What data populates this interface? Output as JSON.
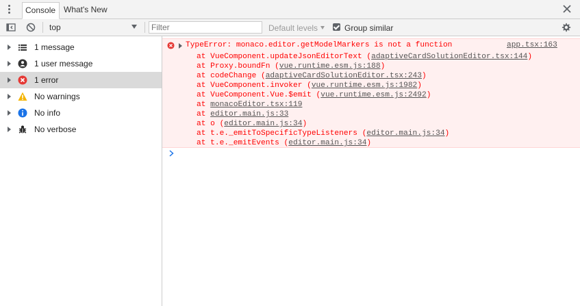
{
  "tabs": {
    "active": "Console",
    "inactive": "What's New"
  },
  "toolbar": {
    "context": "top",
    "filter_placeholder": "Filter",
    "levels": "Default levels",
    "group_similar": "Group similar",
    "group_similar_checked": true
  },
  "sidebar": {
    "items": [
      {
        "label": "1 message",
        "icon": "list-icon"
      },
      {
        "label": "1 user message",
        "icon": "user-icon"
      },
      {
        "label": "1 error",
        "icon": "error-icon",
        "selected": true
      },
      {
        "label": "No warnings",
        "icon": "warning-icon"
      },
      {
        "label": "No info",
        "icon": "info-icon"
      },
      {
        "label": "No verbose",
        "icon": "bug-icon"
      }
    ]
  },
  "console": {
    "error": {
      "message": "TypeError: monaco.editor.getModelMarkers is not a function",
      "source": "app.tsx:163",
      "stack": [
        {
          "text": "at VueComponent.updateJsonEditorText (",
          "link": "adaptiveCardSolutionEditor.tsx:144",
          "close": ")"
        },
        {
          "text": "at Proxy.boundFn (",
          "link": "vue.runtime.esm.js:188",
          "close": ")"
        },
        {
          "text": "at codeChange (",
          "link": "adaptiveCardSolutionEditor.tsx:243",
          "close": ")"
        },
        {
          "text": "at VueComponent.invoker (",
          "link": "vue.runtime.esm.js:1982",
          "close": ")"
        },
        {
          "text": "at VueComponent.Vue.$emit (",
          "link": "vue.runtime.esm.js:2492",
          "close": ")"
        },
        {
          "text": "at ",
          "link": "monacoEditor.tsx:119",
          "close": ""
        },
        {
          "text": "at ",
          "link": "editor.main.js:33",
          "close": ""
        },
        {
          "text": "at o (",
          "link": "editor.main.js:34",
          "close": ")"
        },
        {
          "text": "at t.e._emitToSpecificTypeListeners (",
          "link": "editor.main.js:34",
          "close": ")"
        },
        {
          "text": "at t.e._emitEvents (",
          "link": "editor.main.js:34",
          "close": ")"
        }
      ]
    }
  },
  "colors": {
    "error_text": "#ff0000",
    "error_bg": "#fff0f0",
    "prompt": "#1a73e8"
  }
}
